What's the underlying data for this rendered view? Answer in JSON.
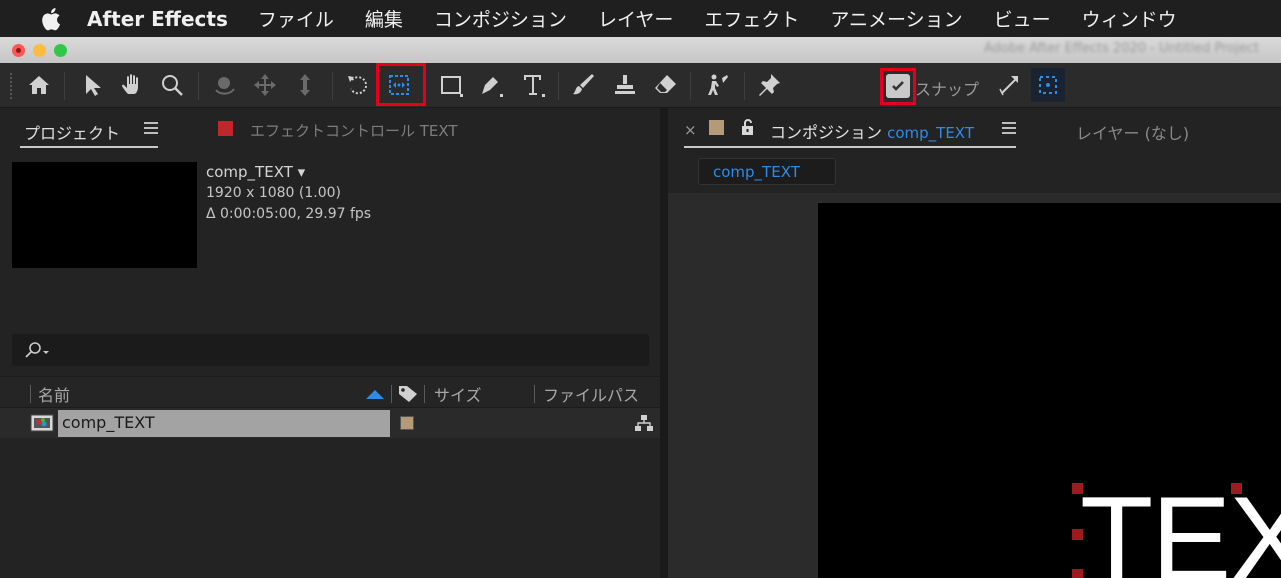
{
  "menubar": {
    "app_name": "After Effects",
    "items": [
      "ファイル",
      "編集",
      "コンポジション",
      "レイヤー",
      "エフェクト",
      "アニメーション",
      "ビュー",
      "ウィンドウ"
    ]
  },
  "titlebar": {
    "title": "Adobe After Effects 2020 - Untitled Project"
  },
  "toolbar": {
    "snap_label": "スナップ",
    "snap_checked": true,
    "highlight_color": "#e4001c",
    "accent_color": "#2d8ceb"
  },
  "project_panel": {
    "tab_label": "プロジェクト",
    "effects_tab_label": "エフェクトコントロール TEXT",
    "comp_name": "comp_TEXT ▾",
    "resolution": "1920 x 1080 (1.00)",
    "duration": "Δ 0:00:05:00, 29.97 fps",
    "search_icon": "search-icon",
    "columns": {
      "name": "名前",
      "size": "サイズ",
      "file_path": "ファイルパス"
    },
    "rows": [
      {
        "name": "comp_TEXT",
        "label_color": "#b49a78"
      }
    ]
  },
  "comp_panel": {
    "tab_label": "コンポジション",
    "comp_name": "comp_TEXT",
    "layer_tab_label": "レイヤー (なし)",
    "sub_tab": "comp_TEXT",
    "canvas_text": "TEX"
  }
}
